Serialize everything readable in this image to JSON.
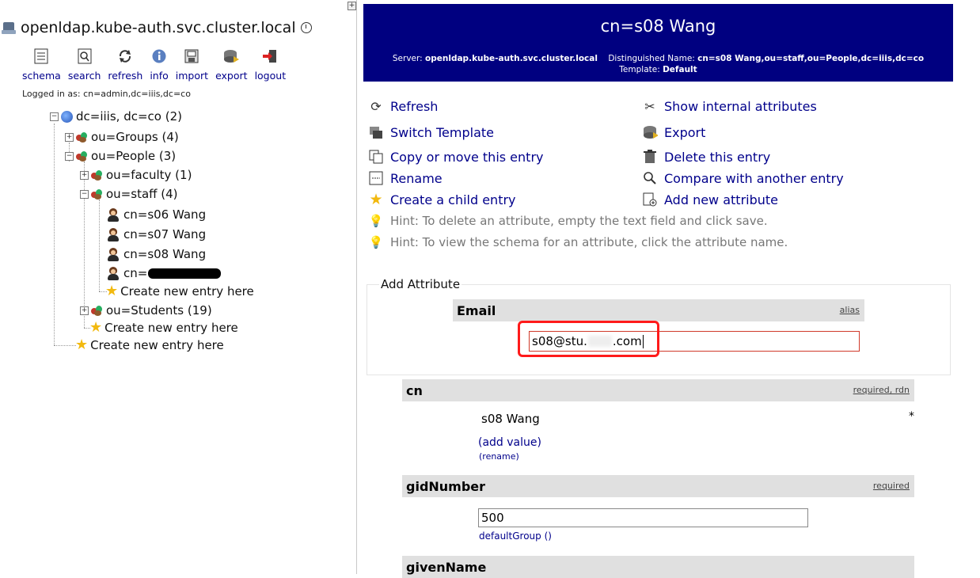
{
  "left": {
    "server": "openldap.kube-auth.svc.cluster.local",
    "toolbar": [
      {
        "label": "schema",
        "icon": "schema-icon"
      },
      {
        "label": "search",
        "icon": "search-icon"
      },
      {
        "label": "refresh",
        "icon": "refresh-icon"
      },
      {
        "label": "info",
        "icon": "info-icon"
      },
      {
        "label": "import",
        "icon": "import-icon"
      },
      {
        "label": "export",
        "icon": "export-icon"
      },
      {
        "label": "logout",
        "icon": "logout-icon"
      }
    ],
    "logged_in": "Logged in as: cn=admin,dc=iiis,dc=co",
    "tree": {
      "root": "dc=iiis, dc=co (2)",
      "groups": "ou=Groups (4)",
      "people": "ou=People (3)",
      "faculty": "ou=faculty (1)",
      "staff": "ou=staff (4)",
      "s06": "cn=s06 Wang",
      "s07": "cn=s07 Wang",
      "s08": "cn=s08 Wang",
      "redacted_prefix": "cn=",
      "create_staff": "Create new entry here",
      "students": "ou=Students (19)",
      "create_people": "Create new entry here",
      "create_root": "Create new entry here"
    }
  },
  "header": {
    "title": "cn=s08 Wang",
    "server_label": "Server:",
    "server_value": "openldap.kube-auth.svc.cluster.local",
    "dn_label": "Distinguished Name:",
    "dn_value": "cn=s08 Wang,ou=staff,ou=People,dc=iiis,dc=co",
    "template_label": "Template:",
    "template_value": "Default"
  },
  "actions": {
    "refresh": "Refresh",
    "switch_template": "Switch Template",
    "copy_move": "Copy or move this entry",
    "rename": "Rename",
    "create_child": "Create a child entry",
    "show_internal": "Show internal attributes",
    "export": "Export",
    "delete": "Delete this entry",
    "compare": "Compare with another entry",
    "add_attr": "Add new attribute",
    "hint1": "Hint: To delete an attribute, empty the text field and click save.",
    "hint2": "Hint: To view the schema for an attribute, click the attribute name."
  },
  "add_attribute": {
    "legend": "Add Attribute",
    "name": "Email",
    "flag": "alias",
    "value_prefix": "s08@stu.",
    "value_suffix": ".com"
  },
  "attributes": {
    "cn": {
      "name": "cn",
      "flags": "required, rdn",
      "value": "s08 Wang",
      "marker": "*",
      "add_value": "(add value)",
      "rename": "(rename)"
    },
    "gidNumber": {
      "name": "gidNumber",
      "flags": "required",
      "value": "500",
      "sub": "defaultGroup ()"
    },
    "givenName": {
      "name": "givenName"
    }
  }
}
